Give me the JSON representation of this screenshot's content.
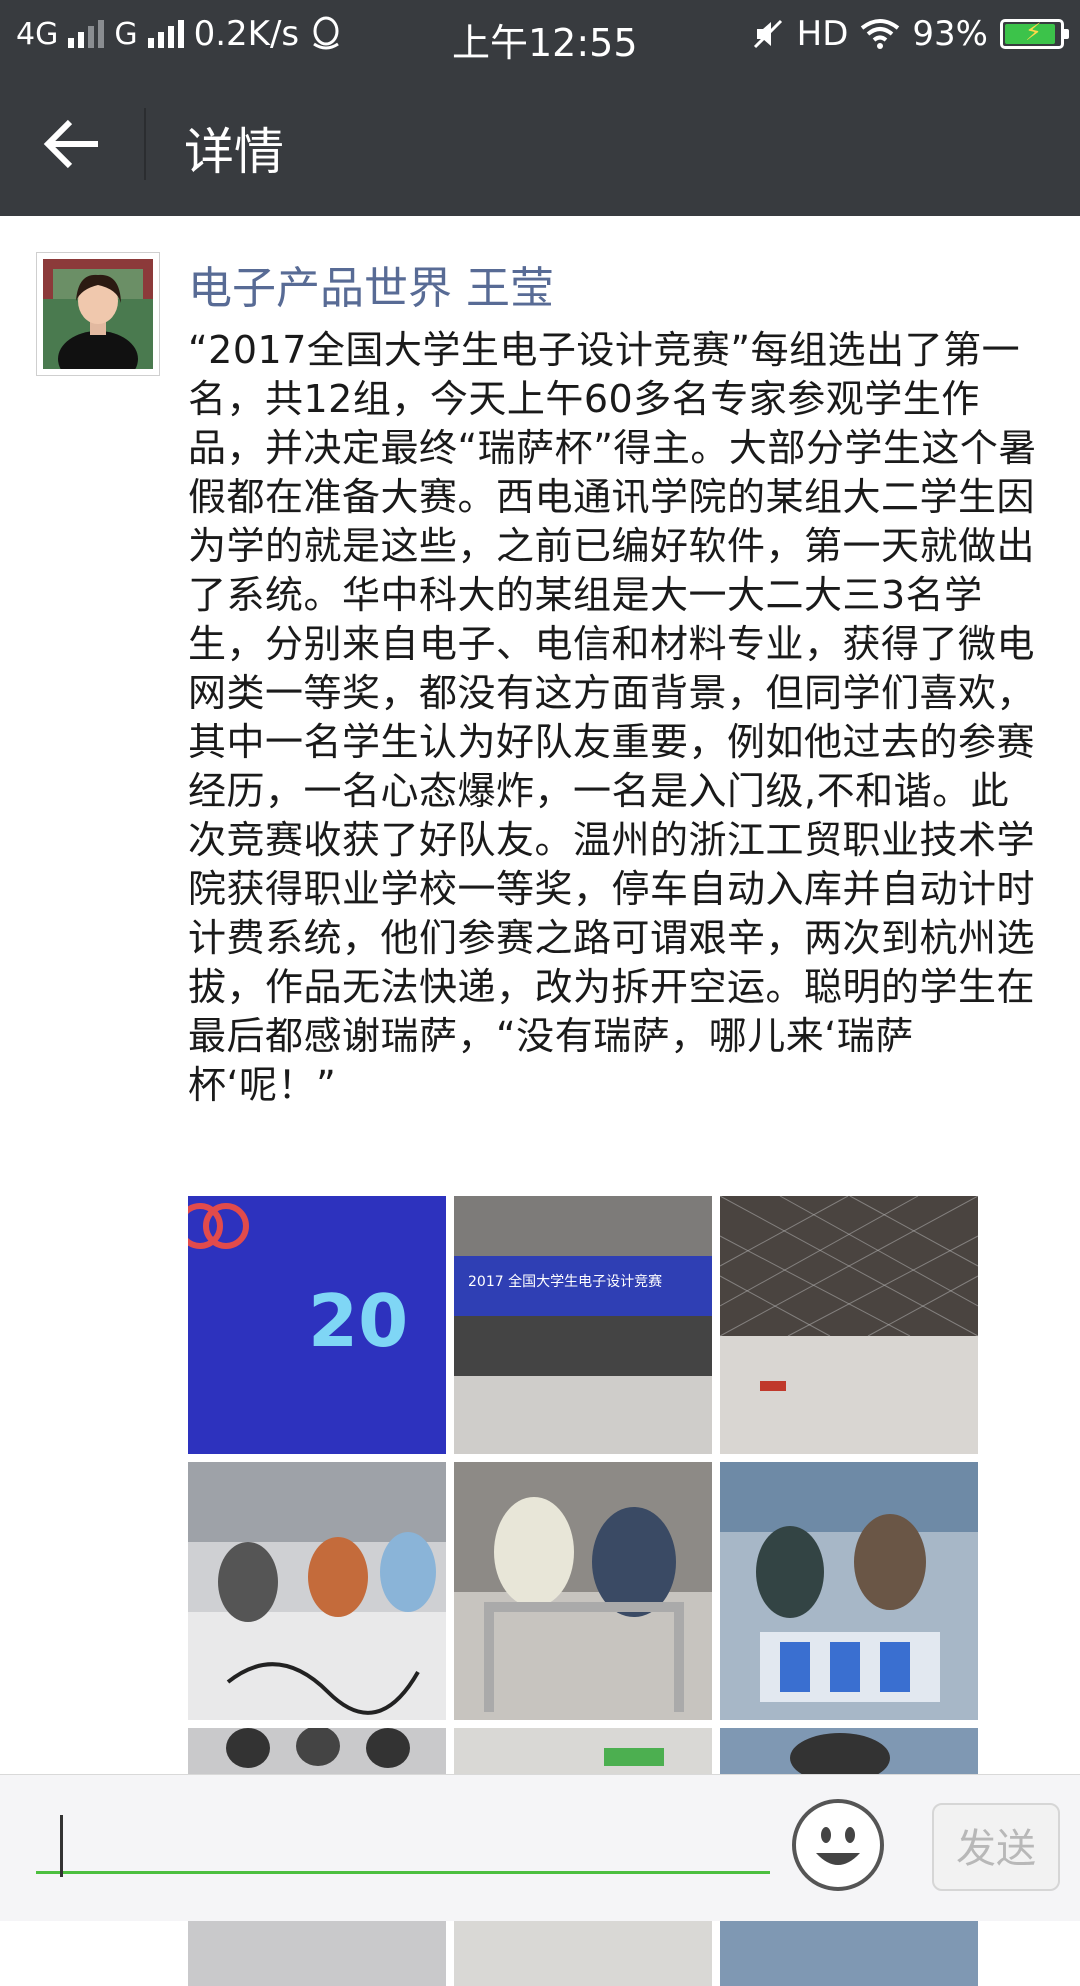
{
  "status_bar": {
    "network_type": "4G",
    "network_type_2": "G",
    "speed": "0.2K/s",
    "time": "上午12:55",
    "hd_label": "HD",
    "battery_percent": "93%",
    "battery_level": 0.93,
    "icons": [
      "signal-icon",
      "qq-icon",
      "mute-icon",
      "wifi-icon",
      "battery-icon"
    ]
  },
  "header": {
    "title": "详情",
    "back_icon": "back-arrow-icon"
  },
  "post": {
    "author": "电子产品世界 王莹",
    "text": "“2017全国大学生电子设计竞赛”每组选出了第一名，共12组，今天上午60多名专家参观学生作品，并决定最终“瑞萨杯”得主。大部分学生这个暑假都在准备大赛。西电通讯学院的某组大二学生因为学的就是这些，之前已编好软件，第一天就做出了系统。华中科大的某组是大一大二大三3名学生，分别来自电子、电信和材料专业，获得了微电网类一等奖，都没有这方面背景，但同学们喜欢，其中一名学生认为好队友重要，例如他过去的参赛经历，一名心态爆炸，一名是入门级,不和谐。此次竞赛收获了好队友。温州的浙江工贸职业技术学院获得职业学校一等奖，停车自动入库并自动计时计费系统，他们参赛之路可谓艰辛，两次到杭州选拔，作品无法快递，改为拆开空运。聪明的学生在最后都感谢瑞萨，“没有瑞萨，哪儿来‘瑞萨杯‘呢！”",
    "photo_labels": [
      "20",
      "2017 全国大学生电子设计竞赛"
    ]
  },
  "composer": {
    "input_value": "",
    "emoji_icon": "smiley-icon",
    "send_label": "发送"
  },
  "colors": {
    "bar_bg": "#383b3f",
    "author": "#586b95",
    "accent_green": "#4cbf3f"
  }
}
